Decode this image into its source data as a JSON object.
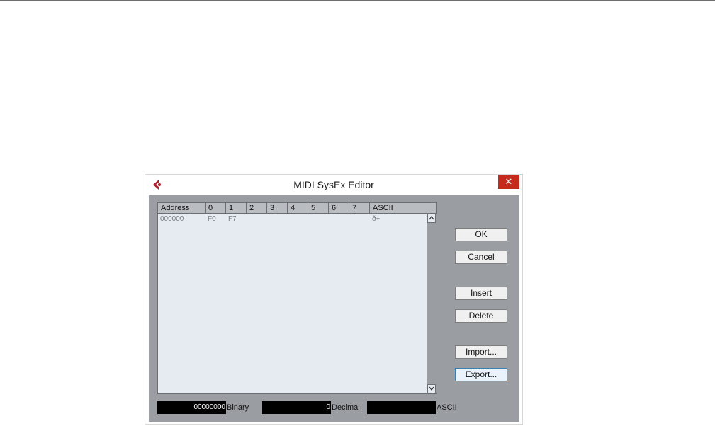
{
  "dialog": {
    "title": "MIDI SysEx Editor",
    "close_glyph": "✕"
  },
  "grid": {
    "columns": [
      "Address",
      "0",
      "1",
      "2",
      "3",
      "4",
      "5",
      "6",
      "7",
      "ASCII"
    ],
    "rows": [
      {
        "address": "000000",
        "bytes": [
          "F0",
          "F7",
          "",
          "",
          "",
          "",
          "",
          ""
        ],
        "ascii": "ð÷"
      }
    ]
  },
  "buttons": {
    "ok": "OK",
    "cancel": "Cancel",
    "insert": "Insert",
    "delete": "Delete",
    "import": "Import...",
    "export": "Export..."
  },
  "fields": {
    "binary_value": "00000000",
    "binary_label": "Binary",
    "decimal_value": "0",
    "decimal_label": "Decimal",
    "ascii_value": "",
    "ascii_label": "ASCII"
  },
  "icons": {
    "logo": "cubase-logo-icon",
    "scroll_up": "chevron-up-icon",
    "scroll_down": "chevron-down-icon"
  },
  "colors": {
    "client_bg": "#9a9ea3",
    "grid_bg": "#e6ebf2",
    "close_red": "#c42b1c",
    "logo_red": "#b01e2c"
  }
}
